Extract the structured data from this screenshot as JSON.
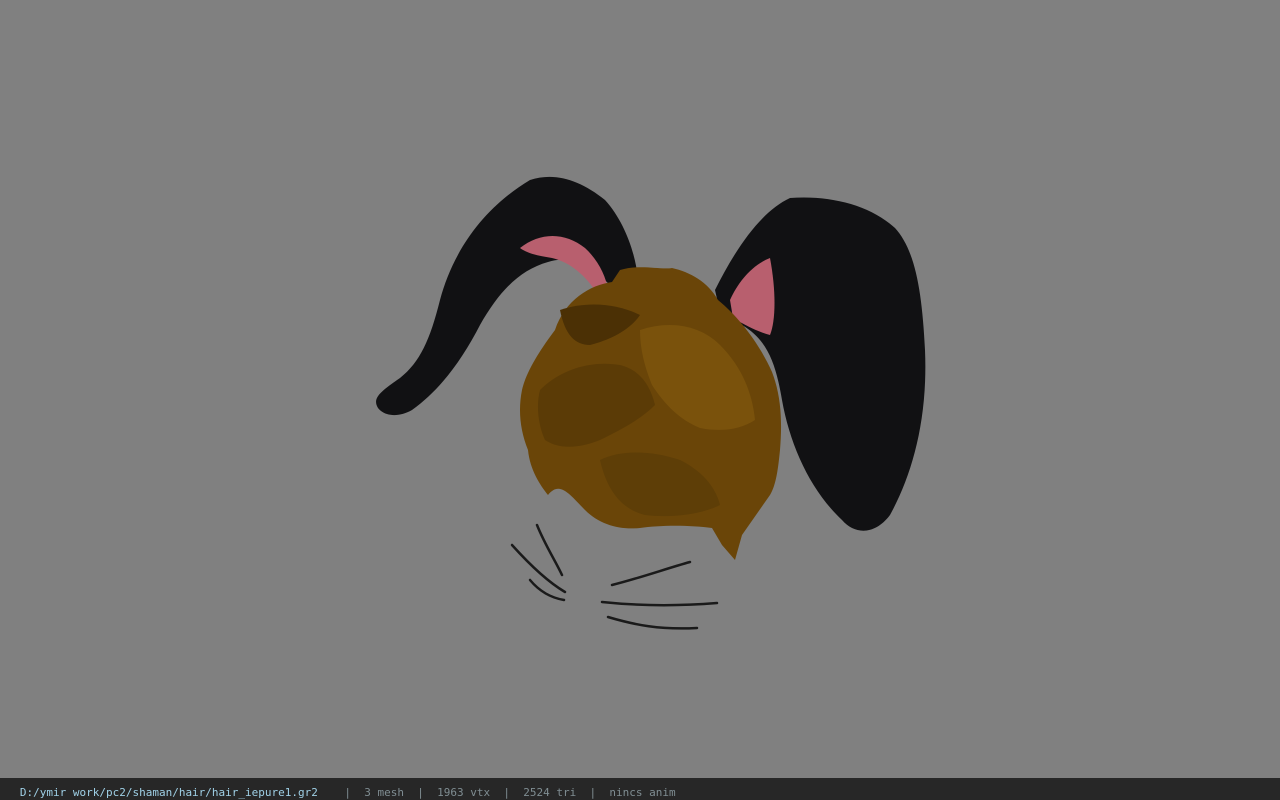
{
  "viewer": {
    "background_color": "#808080",
    "model": {
      "parts": [
        "rabbit-ears",
        "hair",
        "whiskers"
      ],
      "colors": {
        "ear_outer": "#121214",
        "ear_inner": "#b8606e",
        "hair_main": "#6a4508",
        "hair_dark": "#4b3005",
        "hair_light": "#7a520c",
        "whisker": "#1a1a1a"
      }
    }
  },
  "status_bar": {
    "path": "D:/ymir work/pc2/shaman/hair/hair_iepure1.gr2",
    "mesh": "3 mesh",
    "vtx": "1963 vtx",
    "tri": "2524 tri",
    "anim": "nincs anim",
    "separator": "|"
  }
}
